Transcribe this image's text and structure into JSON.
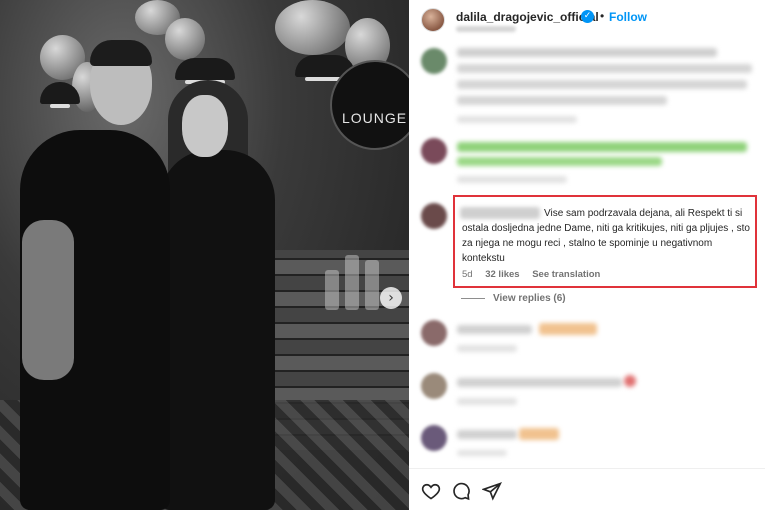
{
  "post": {
    "username": "dalila_dragojevic_official",
    "verified_glyph": "✓",
    "separator": "•",
    "follow_label": "Follow"
  },
  "photo": {
    "sign_text": "LOUNGE",
    "next_glyph": "›"
  },
  "highlighted_comment": {
    "text": "Vise sam podrzavala dejana, ali Respekt ti si ostala dosljedna jedne Dame, niti ga kritikujes, niti ga pljujes , sto za njega ne mogu reci , stalno te spominje u negativnom kontekstu",
    "age": "5d",
    "likes": "32 likes",
    "translation_link": "See translation"
  },
  "view_replies_label": "View replies (6)",
  "actions": {
    "like_icon": "heart-icon",
    "comment_icon": "comment-icon",
    "share_icon": "send-icon"
  },
  "colors": {
    "accent": "#0095f6",
    "highlight_border": "#e0323a",
    "muted_text": "#737373"
  }
}
